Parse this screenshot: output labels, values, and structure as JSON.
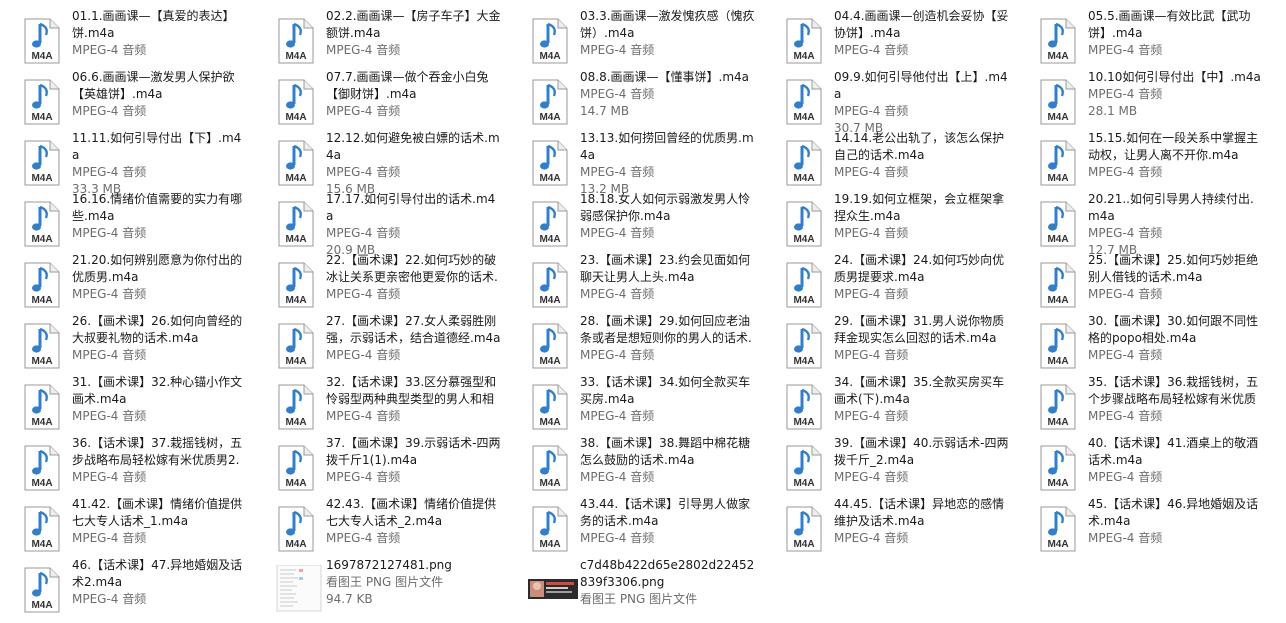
{
  "type_label": "MPEG-4 音频",
  "png_type_label": "看图王 PNG 图片文件",
  "icon_badge": "M4A",
  "colors": {
    "name": "#1a1a1a",
    "meta": "#6d6d6d",
    "note": "#2f7fd0"
  },
  "files": [
    {
      "name": "01.1.画画课—【真爱的表达】饼.m4a",
      "type": "MPEG-4 音频",
      "icon": "m4a-file-icon"
    },
    {
      "name": "02.2.画画课—【房子车子】大金额饼.m4a",
      "type": "MPEG-4 音频",
      "icon": "m4a-file-icon"
    },
    {
      "name": "03.3.画画课—激发愧疚感（愧疚饼）.m4a",
      "type": "MPEG-4 音频",
      "icon": "m4a-file-icon"
    },
    {
      "name": "04.4.画画课—创造机会妥协【妥协饼】.m4a",
      "type": "MPEG-4 音频",
      "icon": "m4a-file-icon"
    },
    {
      "name": "05.5.画画课—有效比武【武功饼】.m4a",
      "type": "MPEG-4 音频",
      "icon": "m4a-file-icon"
    },
    {
      "name": "06.6.画画课—激发男人保护欲【英雄饼】.m4a",
      "type": "MPEG-4 音频",
      "icon": "m4a-file-icon"
    },
    {
      "name": "07.7.画画课—做个吞金小白兔【御财饼】.m4a",
      "type": "MPEG-4 音频",
      "icon": "m4a-file-icon"
    },
    {
      "name": "08.8.画画课—【懂事饼】.m4a",
      "type": "MPEG-4 音频",
      "size": "14.7 MB",
      "icon": "m4a-file-icon"
    },
    {
      "name": "09.9.如何引导他付出【上】.m4a",
      "type": "MPEG-4 音频",
      "size": "30.7 MB",
      "icon": "m4a-file-icon"
    },
    {
      "name": "10.10如何引导付出【中】.m4a",
      "type": "MPEG-4 音频",
      "size": "28.1 MB",
      "icon": "m4a-file-icon"
    },
    {
      "name": "11.11.如何引导付出【下】.m4a",
      "type": "MPEG-4 音频",
      "size": "33.3 MB",
      "icon": "m4a-file-icon"
    },
    {
      "name": "12.12.如何避免被白嫖的话术.m4a",
      "type": "MPEG-4 音频",
      "size": "15.6 MB",
      "icon": "m4a-file-icon"
    },
    {
      "name": "13.13.如何捞回曾经的优质男.m4a",
      "type": "MPEG-4 音频",
      "size": "13.2 MB",
      "icon": "m4a-file-icon"
    },
    {
      "name": "14.14.老公出轨了，该怎么保护自己的话术.m4a",
      "type": "MPEG-4 音频",
      "icon": "m4a-file-icon"
    },
    {
      "name": "15.15.如何在一段关系中掌握主动权，让男人离不开你.m4a",
      "type": "MPEG-4 音频",
      "icon": "m4a-file-icon"
    },
    {
      "name": "16.16.情绪价值需要的实力有哪些.m4a",
      "type": "MPEG-4 音频",
      "icon": "m4a-file-icon"
    },
    {
      "name": "17.17.如何引导付出的话术.m4a",
      "type": "MPEG-4 音频",
      "size": "20.9 MB",
      "icon": "m4a-file-icon"
    },
    {
      "name": "18.18.女人如何示弱激发男人怜弱感保护你.m4a",
      "type": "MPEG-4 音频",
      "icon": "m4a-file-icon"
    },
    {
      "name": "19.19.如何立框架，会立框架拿捏众生.m4a",
      "type": "MPEG-4 音频",
      "icon": "m4a-file-icon"
    },
    {
      "name": "20.21..如何引导男人持续付出.m4a",
      "type": "MPEG-4 音频",
      "size": "12.7 MB",
      "icon": "m4a-file-icon"
    },
    {
      "name": "21.20.如何辨别愿意为你付出的优质男.m4a",
      "type": "MPEG-4 音频",
      "icon": "m4a-file-icon"
    },
    {
      "name": "22.【画术课】22.如何巧妙的破冰让关系更亲密他更爱你的话术.m4a",
      "type": "MPEG-4 音频",
      "icon": "m4a-file-icon"
    },
    {
      "name": "23.【画术课】23.约会见面如何聊天让男人上头.m4a",
      "type": "MPEG-4 音频",
      "icon": "m4a-file-icon"
    },
    {
      "name": "24.【画术课】24.如何巧妙向优质男提要求.m4a",
      "type": "MPEG-4 音频",
      "icon": "m4a-file-icon"
    },
    {
      "name": "25.【画术课】25.如何巧妙拒绝别人借钱的话术.m4a",
      "type": "MPEG-4 音频",
      "icon": "m4a-file-icon"
    },
    {
      "name": "26.【画术课】26.如何向曾经的大叔要礼物的话术.m4a",
      "type": "MPEG-4 音频",
      "icon": "m4a-file-icon"
    },
    {
      "name": "27.【画术课】27.女人柔弱胜刚强，示弱话术，结合道德经.m4a",
      "type": "MPEG-4 音频",
      "icon": "m4a-file-icon"
    },
    {
      "name": "28.【画术课】29.如何回应老油条或者是想短则你的男人的话术.m4a",
      "type": "MPEG-4 音频",
      "icon": "m4a-file-icon"
    },
    {
      "name": "29.【画术课】31.男人说你物质拜金现实怎么回怼的话术.m4a",
      "type": "MPEG-4 音频",
      "icon": "m4a-file-icon"
    },
    {
      "name": "30.【画术课】30.如何跟不同性格的popo相处.m4a",
      "type": "MPEG-4 音频",
      "icon": "m4a-file-icon"
    },
    {
      "name": "31.【画术课】32.种心锚小作文画术.m4a",
      "type": "MPEG-4 音频",
      "icon": "m4a-file-icon"
    },
    {
      "name": "32.【话术课】33.区分慕强型和怜弱型两种典型类型的男人和相处...",
      "type": "MPEG-4 音频",
      "icon": "m4a-file-icon"
    },
    {
      "name": "33.【话术课】34.如何全款买车买房.m4a",
      "type": "MPEG-4 音频",
      "icon": "m4a-file-icon"
    },
    {
      "name": "34.【画术课】35.全款买房买车画术(下).m4a",
      "type": "MPEG-4 音频",
      "icon": "m4a-file-icon"
    },
    {
      "name": "35.【话术课】36.栽摇钱树，五个步骤战略布局轻松嫁有米优质男1....",
      "type": "MPEG-4 音频",
      "icon": "m4a-file-icon"
    },
    {
      "name": "36.【话术课】37.栽摇钱树，五步战略布局轻松嫁有米优质男2.m4a",
      "type": "MPEG-4 音频",
      "icon": "m4a-file-icon"
    },
    {
      "name": "37.【画术课】39.示弱话术-四两拨千斤1(1).m4a",
      "type": "MPEG-4 音频",
      "icon": "m4a-file-icon"
    },
    {
      "name": "38.【画术课】38.舞蹈中棉花糖怎么鼓励的话术.m4a",
      "type": "MPEG-4 音频",
      "icon": "m4a-file-icon"
    },
    {
      "name": "39.【画术课】40.示弱话术-四两拨千斤_2.m4a",
      "type": "MPEG-4 音频",
      "icon": "m4a-file-icon"
    },
    {
      "name": "40.【话术课】41.酒桌上的敬酒话术.m4a",
      "type": "MPEG-4 音频",
      "icon": "m4a-file-icon"
    },
    {
      "name": "41.42.【画术课】情绪价值提供七大专人话术_1.m4a",
      "type": "MPEG-4 音频",
      "icon": "m4a-file-icon"
    },
    {
      "name": "42.43.【画术课】情绪价值提供七大专人话术_2.m4a",
      "type": "MPEG-4 音频",
      "icon": "m4a-file-icon"
    },
    {
      "name": "43.44.【话术课】引导男人做家务的话术.m4a",
      "type": "MPEG-4 音频",
      "icon": "m4a-file-icon"
    },
    {
      "name": "44.45.【话术课】异地恋的感情维护及话术.m4a",
      "type": "MPEG-4 音频",
      "icon": "m4a-file-icon"
    },
    {
      "name": "45.【话术课】46.异地婚姻及话术.m4a",
      "type": "MPEG-4 音频",
      "icon": "m4a-file-icon"
    },
    {
      "name": "46.【话术课】47.异地婚姻及话术2.m4a",
      "type": "MPEG-4 音频",
      "icon": "m4a-file-icon"
    },
    {
      "name": "1697872127481.png",
      "type": "看图王 PNG 图片文件",
      "size": "94.7 KB",
      "icon": "png-document-thumbnail-icon"
    },
    {
      "name": "c7d48b422d65e2802d22452839f3306.png",
      "type": "看图王 PNG 图片文件",
      "icon": "png-photo-thumbnail-icon"
    }
  ]
}
